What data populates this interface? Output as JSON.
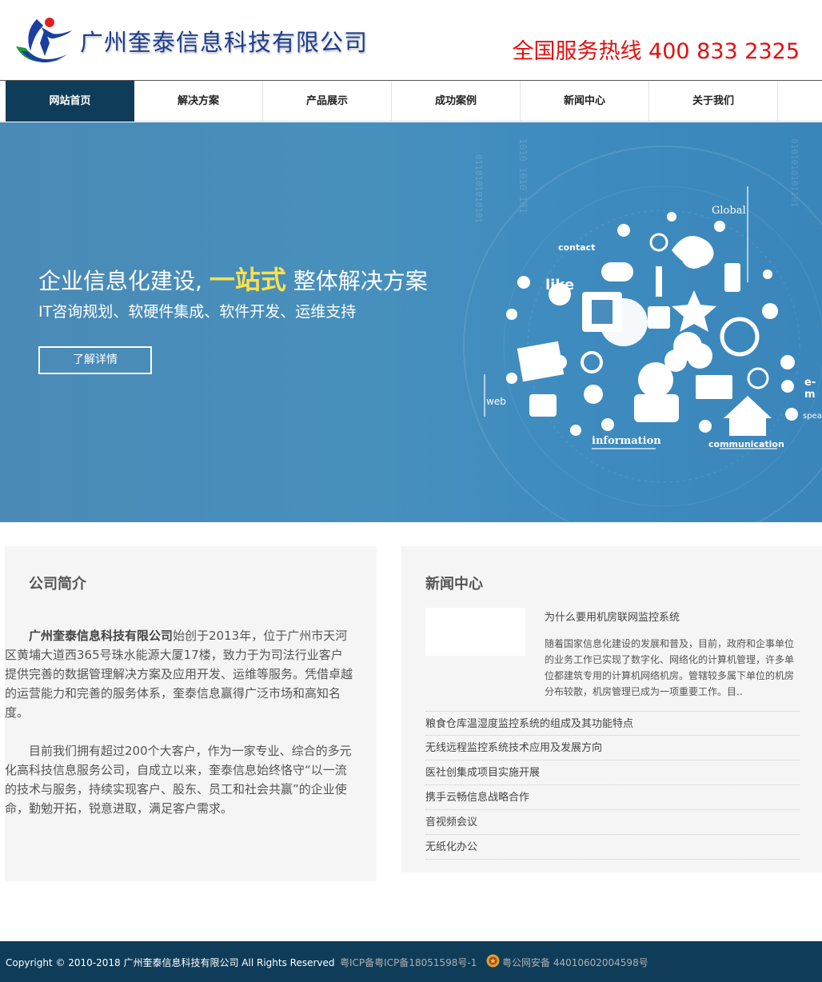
{
  "header": {
    "company_name": "广州奎泰信息科技有限公司",
    "hotline": "全国服务热线 400 833 2325"
  },
  "nav": {
    "items": [
      {
        "label": "网站首页",
        "active": true
      },
      {
        "label": "解决方案",
        "active": false
      },
      {
        "label": "产品展示",
        "active": false
      },
      {
        "label": "成功案例",
        "active": false
      },
      {
        "label": "新闻中心",
        "active": false
      },
      {
        "label": "关于我们",
        "active": false
      }
    ]
  },
  "banner": {
    "title_prefix": "企业信息化建设,",
    "title_highlight": "一站式",
    "title_suffix": "整体解决方案",
    "subtitle": "IT咨询规划、软硬件集成、软件开发、运维支持",
    "button_label": "了解详情",
    "labels": {
      "global": "Global",
      "contact": "contact",
      "like": "like",
      "web": "web",
      "information": "information",
      "communication": "communication",
      "e_mail": "e-m",
      "speak": "speak"
    }
  },
  "about": {
    "title": "公司简介",
    "company_bold": "广州奎泰信息科技有限公司",
    "para1_rest": "始创于2013年，位于广州市天河区黄埔大道西365号珠水能源大厦17楼，致力于为司法行业客户提供完善的数据管理解决方案及应用开发、运维等服务。凭借卓越的运营能力和完善的服务体系，奎泰信息赢得广泛市场和高知名度。",
    "para2": "目前我们拥有超过200个大客户，作为一家专业、综合的多元化高科技信息服务公司，自成立以来，奎泰信息始终恪守“以一流的技术与服务，持续实现客户、股东、员工和社会共赢”的企业使命，勤勉开拓，锐意进取，满足客户需求。"
  },
  "news": {
    "title": "新闻中心",
    "feature_title": "为什么要用机房联网监控系统",
    "feature_desc": "随着国家信息化建设的发展和普及，目前，政府和企事单位的业务工作已实现了数字化、网络化的计算机管理，许多单位都建筑专用的计算机网络机房。管辖较多属下单位的机房分布较散，机房管理已成为一项重要工作。目..",
    "items": [
      "粮食仓库温湿度监控系统的组成及其功能特点",
      "无线远程监控系统技术应用及发展方向",
      "医社创集成项目实施开展",
      "携手云畅信息战略合作",
      "音视频会议",
      "无纸化办公"
    ]
  },
  "footer": {
    "copyright": "Copyright © 2010-2018 广州奎泰信息科技有限公司 All Rights Reserved",
    "icp": "粤ICP备粤ICP备18051598号-1",
    "police": "粤公网安备 44010602004598号"
  },
  "colors": {
    "nav_active": "#0f3d59",
    "hotline": "#e01010",
    "banner_highlight": "#ffe04a",
    "footer_bg": "#0f3d59"
  }
}
